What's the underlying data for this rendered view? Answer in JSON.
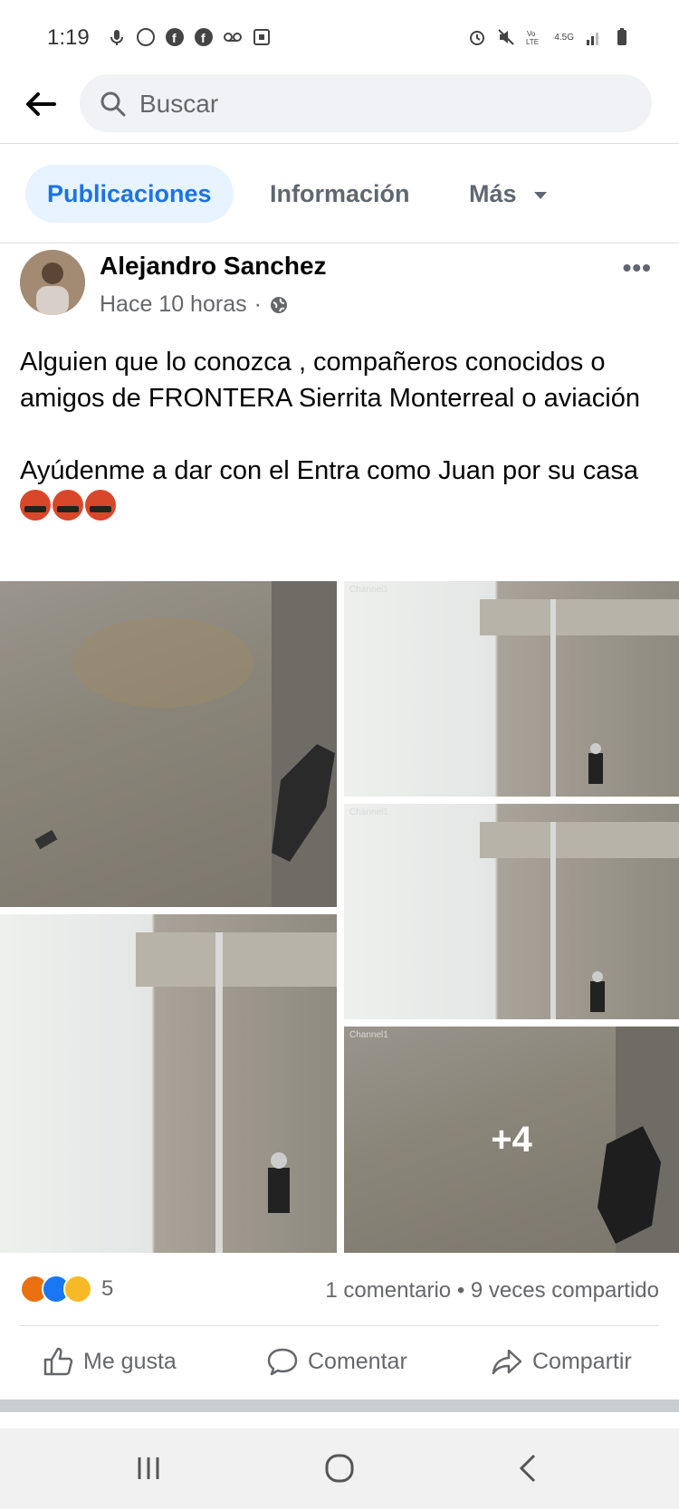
{
  "status": {
    "time": "1:19",
    "network": "4.5G"
  },
  "search": {
    "placeholder": "Buscar"
  },
  "tabs": [
    {
      "label": "Publicaciones"
    },
    {
      "label": "Información"
    },
    {
      "label": "Más"
    }
  ],
  "post": {
    "author": "Alejandro Sanchez",
    "time": "Hace 10 horas",
    "text1": "Alguien que lo conozca , compañeros conocidos o amigos de FRONTERA Sierrita Monterreal  o aviación",
    "text2": "Ayúdenme a dar con el Entra como Juan por su casa",
    "emojis": [
      "angry-symbols-emoji",
      "angry-symbols-emoji",
      "angry-symbols-emoji"
    ],
    "more_photos": "+4",
    "photo_labels": [
      "Channel1",
      "Channel1",
      "Channel1"
    ],
    "reaction_count": "5",
    "comments": "1 comentario",
    "shares": "9 veces compartido"
  },
  "actions": {
    "like": "Me gusta",
    "comment": "Comentar",
    "share": "Compartir"
  },
  "colors": {
    "accent": "#1b74e4",
    "tab_active_bg": "#e7f3ff",
    "muted": "#65676b"
  }
}
